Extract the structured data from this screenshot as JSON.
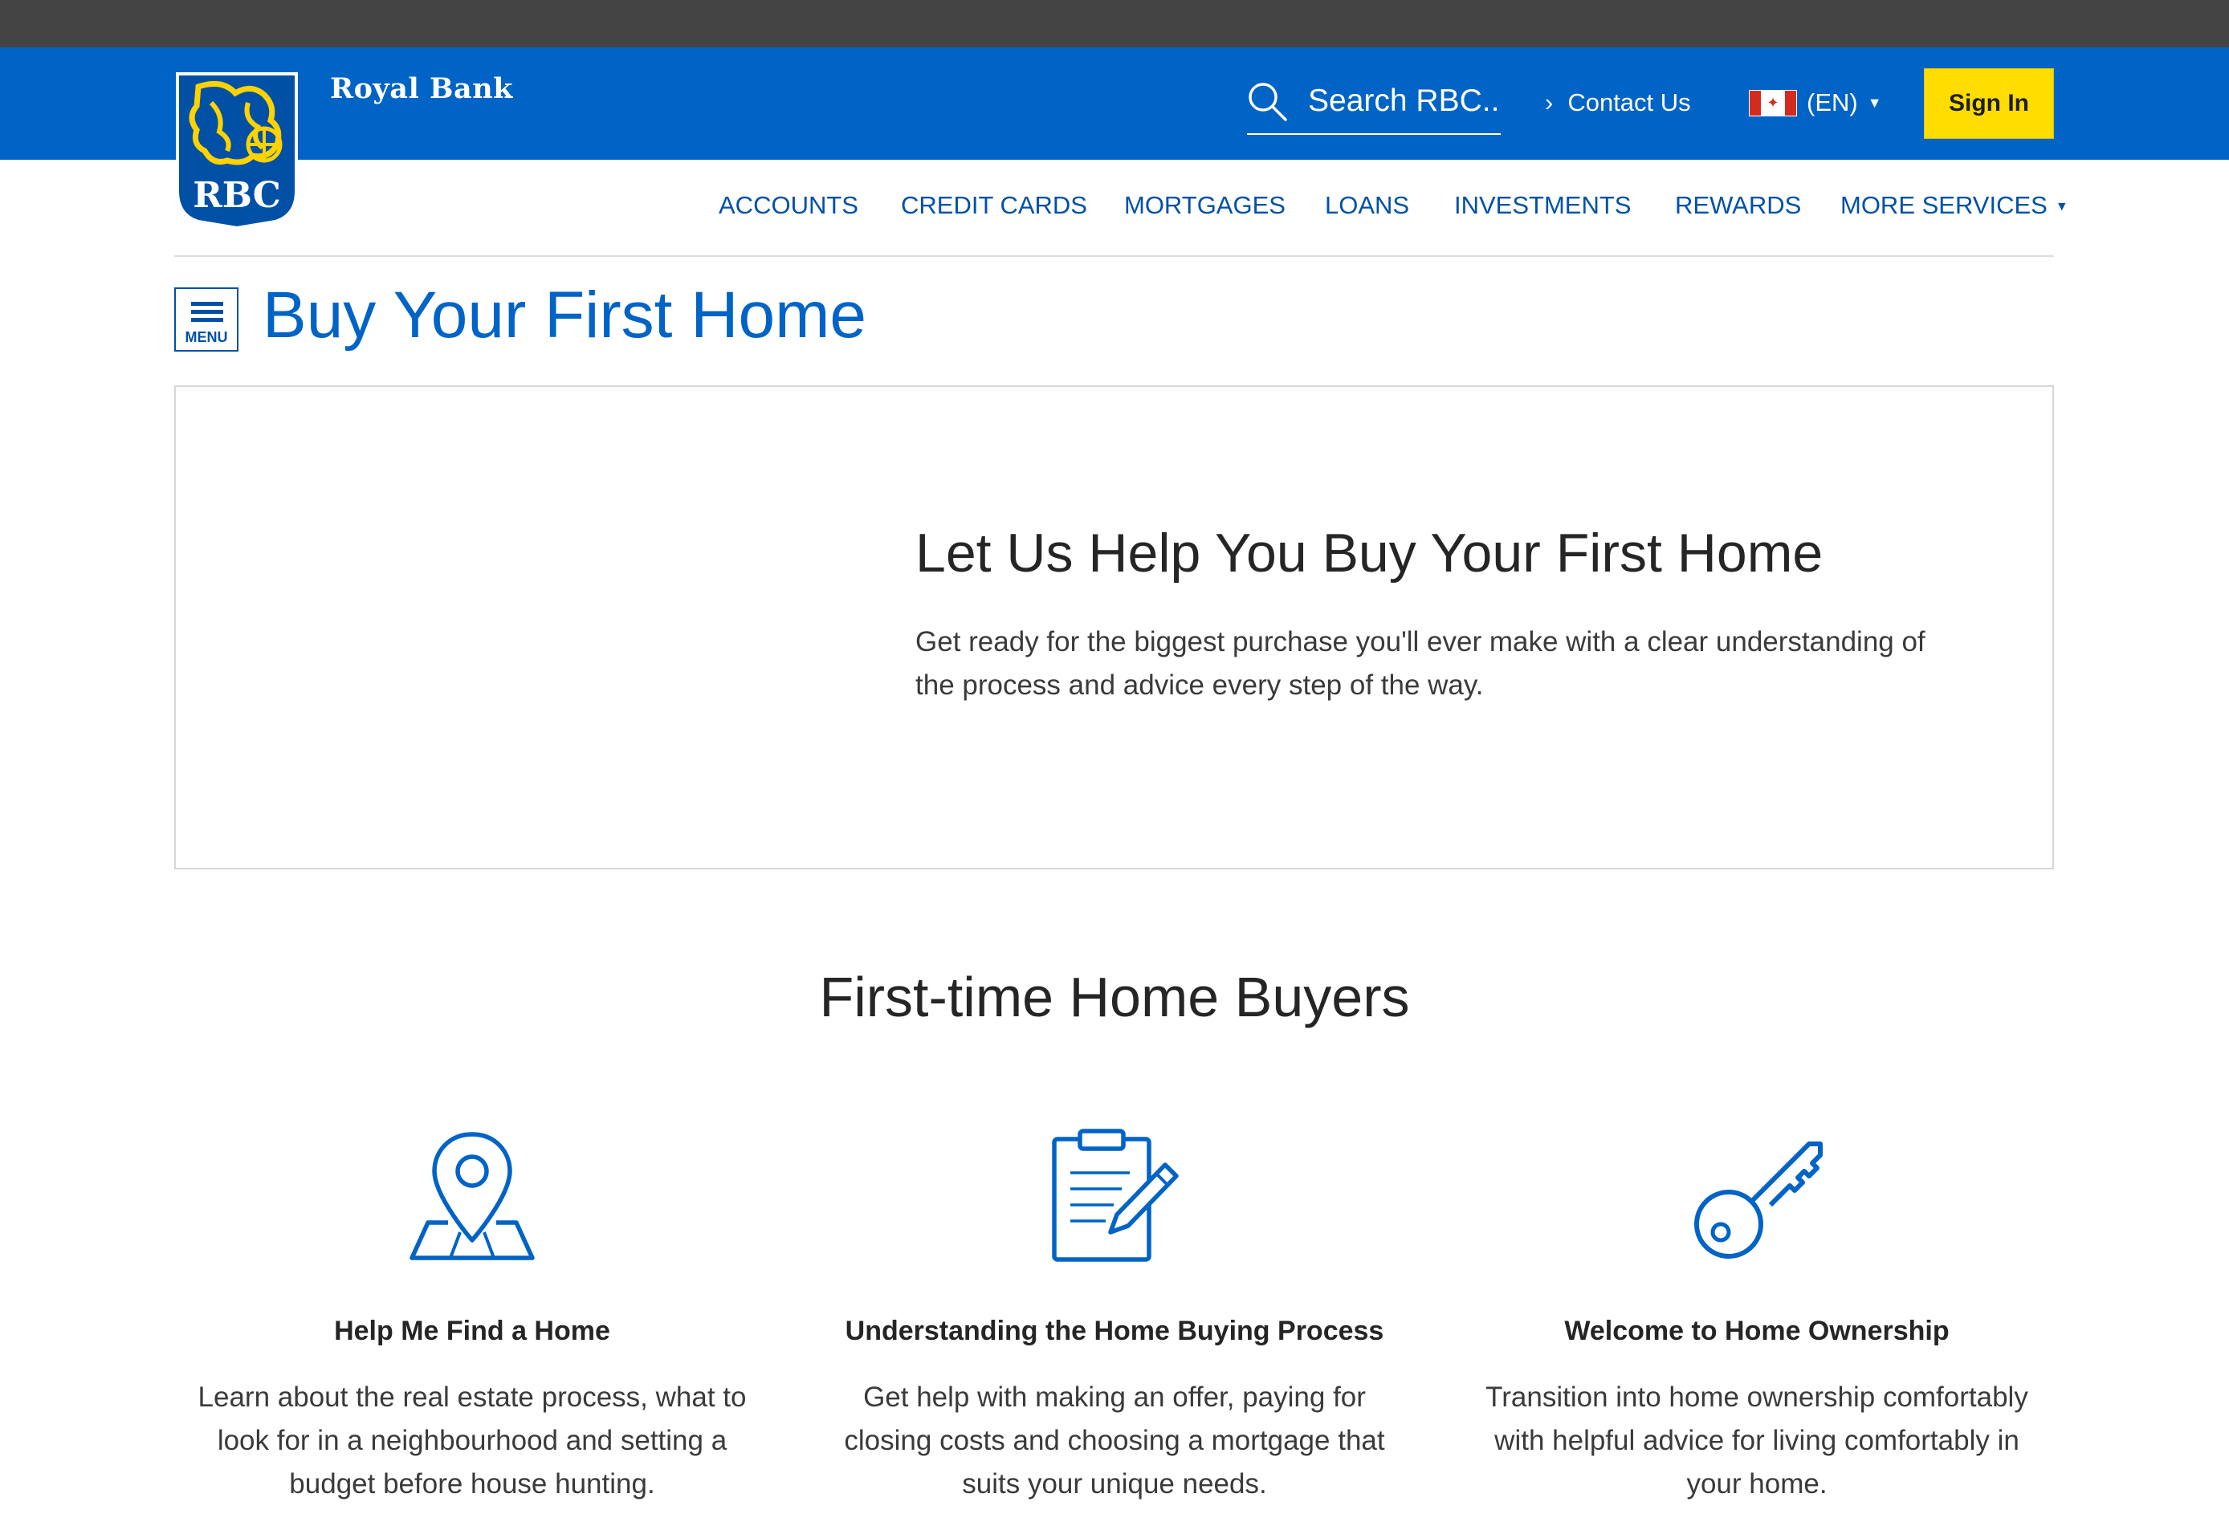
{
  "header": {
    "brand_name": "Royal Bank",
    "logo_text": "RBC",
    "search_placeholder": "Search RBC...",
    "contact_label": "Contact Us",
    "language_label": "(EN)",
    "sign_in_label": "Sign In"
  },
  "nav": {
    "items": [
      {
        "label": "ACCOUNTS"
      },
      {
        "label": "CREDIT CARDS"
      },
      {
        "label": "MORTGAGES"
      },
      {
        "label": "LOANS"
      },
      {
        "label": "INVESTMENTS"
      },
      {
        "label": "REWARDS"
      },
      {
        "label": "MORE SERVICES"
      }
    ]
  },
  "page": {
    "menu_label": "MENU",
    "title": "Buy Your First Home"
  },
  "hero": {
    "heading": "Let Us Help You Buy Your First Home",
    "text": "Get ready for the biggest purchase you'll ever make with a clear understanding of the process and advice every step of the way."
  },
  "section": {
    "title": "First-time Home Buyers",
    "features": [
      {
        "icon": "map-pin-icon",
        "title": "Help Me Find a Home",
        "description": "Learn about the real estate process, what to look for in a neighbourhood and setting a budget before house hunting."
      },
      {
        "icon": "clipboard-pen-icon",
        "title": "Understanding the Home Buying Process",
        "description": "Get help with making an offer, paying for closing costs and choosing a mortgage that suits your unique needs."
      },
      {
        "icon": "key-icon",
        "title": "Welcome to Home Ownership",
        "description": "Transition into home ownership comfortably with helpful advice for living comfortably in your home."
      }
    ]
  },
  "colors": {
    "brand_blue": "#0063c6",
    "link_blue": "#0051a5",
    "sign_in_yellow": "#ffdd00",
    "browser_bar": "#444444"
  }
}
